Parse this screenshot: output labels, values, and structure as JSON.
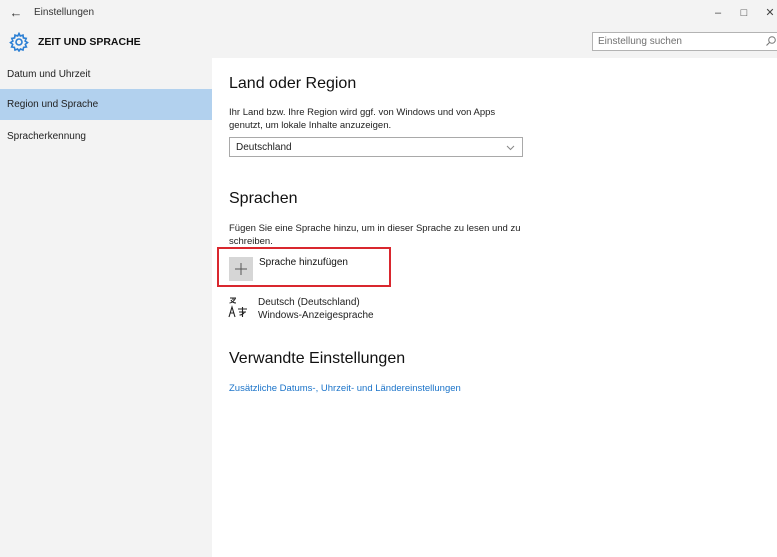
{
  "window": {
    "title": "Einstellungen",
    "back_icon": "←",
    "minimize_icon": "–",
    "maximize_icon": "□",
    "close_icon": "✕"
  },
  "header": {
    "title": "ZEIT UND SPRACHE",
    "search_placeholder": "Einstellung suchen"
  },
  "sidebar": {
    "items": [
      {
        "label": "Datum und Uhrzeit",
        "selected": false
      },
      {
        "label": "Region und Sprache",
        "selected": true
      },
      {
        "label": "Spracherkennung",
        "selected": false
      }
    ]
  },
  "main": {
    "region": {
      "heading": "Land oder Region",
      "description_line1": "Ihr Land bzw. Ihre Region wird ggf. von Windows und von Apps",
      "description_line2": "genutzt, um lokale Inhalte anzuzeigen.",
      "selected_country": "Deutschland"
    },
    "languages": {
      "heading": "Sprachen",
      "description_line1": "Fügen Sie eine Sprache hinzu, um in dieser Sprache zu lesen und zu",
      "description_line2": "schreiben.",
      "add_label": "Sprache hinzufügen",
      "add_icon": "+",
      "installed": {
        "name": "Deutsch (Deutschland)",
        "subtitle": "Windows-Anzeigesprache"
      }
    },
    "related": {
      "heading": "Verwandte Einstellungen",
      "link": "Zusätzliche Datums-, Uhrzeit- und Ländereinstellungen"
    }
  },
  "colors": {
    "accent": "#1a73c9",
    "selected_nav": "#b2d1ee",
    "highlight_border": "#d9272e",
    "chrome": "#f3f3f3"
  }
}
